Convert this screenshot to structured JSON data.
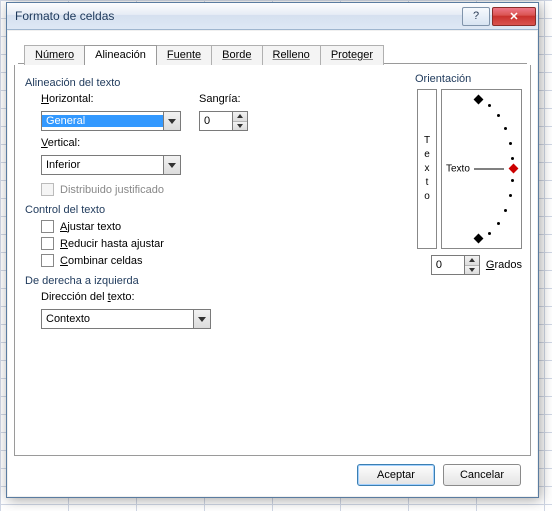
{
  "dialog": {
    "title": "Formato de celdas"
  },
  "tabs": {
    "numero": "Número",
    "alineacion": "Alineación",
    "fuente": "Fuente",
    "borde": "Borde",
    "relleno": "Relleno",
    "proteger": "Proteger"
  },
  "alignment": {
    "group_text": "Alineación del texto",
    "horizontal_label": "Horizontal:",
    "horizontal_value": "General",
    "indent_label": "Sangría:",
    "indent_value": "0",
    "vertical_label": "Vertical:",
    "vertical_value": "Inferior",
    "justify_distributed": "Distribuido justificado"
  },
  "textcontrol": {
    "group": "Control del texto",
    "wrap": "Ajustar texto",
    "shrink": "Reducir hasta ajustar",
    "merge": "Combinar celdas"
  },
  "rtl": {
    "group": "De derecha a izquierda",
    "direction_label": "Dirección del texto:",
    "direction_value": "Contexto"
  },
  "orientation": {
    "group": "Orientación",
    "vertical_letters": [
      "T",
      "e",
      "x",
      "t",
      "o"
    ],
    "dial_label": "Texto",
    "degrees_value": "0",
    "degrees_label": "Grados"
  },
  "buttons": {
    "ok": "Aceptar",
    "cancel": "Cancelar"
  },
  "titlebar": {
    "help": "?",
    "close": "✕"
  }
}
